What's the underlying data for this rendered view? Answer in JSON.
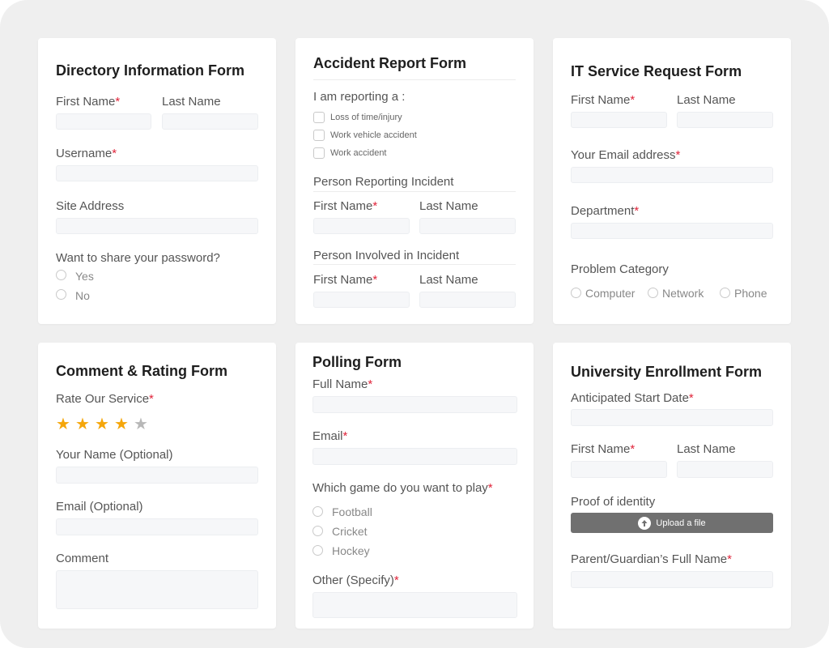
{
  "directory": {
    "title": "Directory Information Form",
    "first_name": "First Name",
    "last_name": "Last Name",
    "username": "Username",
    "site_address": "Site Address",
    "question": "Want to share your password?",
    "yes": "Yes",
    "no": "No"
  },
  "accident": {
    "title": "Accident Report Form",
    "reporting": "I am reporting a :",
    "options": [
      "Loss of time/injury",
      "Work vehicle accident",
      "Work accident"
    ],
    "reporting_section": "Person Reporting Incident",
    "involved_section": "Person Involved in Incident",
    "first_name": "First Name",
    "last_name": "Last Name"
  },
  "it": {
    "title": "IT Service Request Form",
    "first_name": "First Name",
    "last_name": "Last Name",
    "email": "Your Email address",
    "department": "Department",
    "problem": "Problem Category",
    "options": [
      "Computer",
      "Network",
      "Phone"
    ]
  },
  "comment": {
    "title": "Comment & Rating Form",
    "rate": "Rate Our Service",
    "rating": 4,
    "rating_max": 5,
    "name": "Your Name (Optional)",
    "email": "Email (Optional)",
    "comment": "Comment"
  },
  "polling": {
    "title": "Polling Form",
    "full_name": "Full Name",
    "email": "Email",
    "question": "Which game do you want to play",
    "options": [
      "Football",
      "Cricket",
      "Hockey"
    ],
    "other": "Other (Specify)"
  },
  "university": {
    "title": "University Enrollment Form",
    "start_date": "Anticipated Start Date",
    "first_name": "First Name",
    "last_name": "Last Name",
    "proof": "Proof of identity",
    "upload": "Upload a file",
    "guardian": "Parent/Guardian’s Full Name"
  },
  "required_mark": "*",
  "colors": {
    "background": "#efefef",
    "card": "#ffffff",
    "input": "#f6f7f9",
    "required": "#e0243a",
    "star_filled": "#f5a60a",
    "star_empty": "#b8b8b8",
    "upload_button": "#707070"
  },
  "icons": {
    "star": "star-icon",
    "upload": "cloud-upload-icon"
  }
}
